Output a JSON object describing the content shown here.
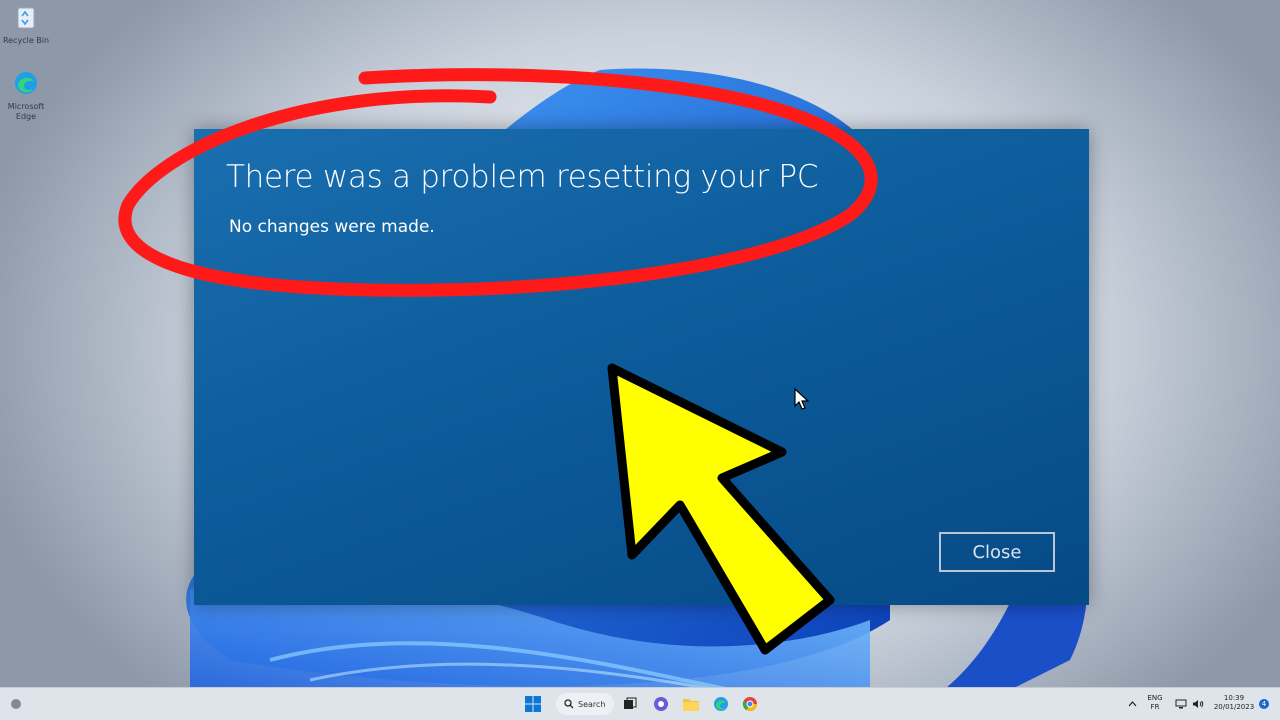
{
  "desktop": {
    "icons": [
      {
        "label": "Recycle Bin",
        "icon": "recycle-bin-icon"
      },
      {
        "label": "Microsoft Edge",
        "icon": "edge-icon"
      }
    ]
  },
  "dialog": {
    "title": "There was a problem resetting your PC",
    "message": "No changes were made.",
    "close_label": "Close"
  },
  "taskbar": {
    "search_label": "Search",
    "language_primary": "ENG",
    "language_secondary": "FR",
    "time": "10:39",
    "date": "20/01/2023",
    "notification_count": "4"
  },
  "colors": {
    "dialog_bg": "#0d5c9b",
    "annotation_red": "#ff1a1a",
    "annotation_yellow": "#ffff00"
  }
}
